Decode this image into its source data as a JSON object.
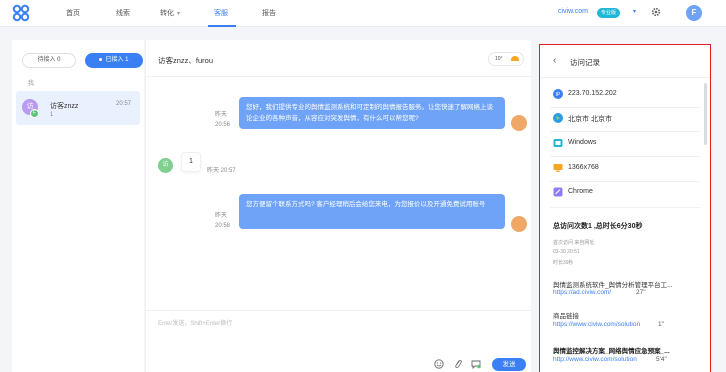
{
  "topbar": {
    "nav": [
      "首页",
      "线索",
      "转化",
      "客服",
      "报告"
    ],
    "active_nav": "客服",
    "site": "civiw.com",
    "edition_badge": "专业版",
    "avatar_letter": "F"
  },
  "left": {
    "tab_waiting": "待接入 0",
    "tab_joined": "已接入 1",
    "group_label": "我",
    "conversation": {
      "avatar": "访",
      "sub_avatar": "F",
      "name": "访客znzz",
      "time": "20:57",
      "last_message": "1"
    }
  },
  "chat": {
    "title": "访客znzz、furou",
    "weather_temp": "10°",
    "messages": [
      {
        "from": "agent",
        "day": "昨天",
        "time": "20:56",
        "text": "您好，我们提供专业的舆情监测系统和可定制的舆情报告服务。让您快速了解网络上谈论企业的各种声音，从容应对突发舆情，有什么可以帮您呢?"
      },
      {
        "from": "visitor",
        "avatar": "访",
        "text": "1",
        "time": "昨天 20:57"
      },
      {
        "from": "agent",
        "day": "昨天",
        "time": "20:58",
        "text": "您方便留个联系方式吗? 客户经理稍后会给您来电，为您报价以及开通免费试用账号"
      }
    ],
    "input_placeholder": "Enter发送，Shift+Enter换行",
    "send_label": "发送"
  },
  "visit": {
    "title": "访问记录",
    "ip": "223.70.152.202",
    "location": "北京市 北京市",
    "os": "Windows",
    "resolution": "1366x768",
    "browser": "Chrome",
    "stats": "总访问次数1 ,总时长6分30秒",
    "meta_labels": "首次访问   来自网址",
    "first_visit": "03-30 20:51",
    "duration": "时长39秒",
    "sources": [
      {
        "title": "舆情监测系统软件_舆情分析管理平台工...",
        "url": "https://ad.civiw.com/",
        "dur": "27\"",
        "bold": false
      },
      {
        "title": "商品链接",
        "url": "https://www.civiw.com/solution",
        "dur": "1\"",
        "bold": false
      },
      {
        "title": "舆情监控解决方案_网络舆情应急预案_...",
        "url": "http://www.civiw.com/solution",
        "dur": "5'4\"",
        "bold": true
      }
    ]
  },
  "colors": {
    "accent": "#3b7ff5",
    "bubble": "#6fa3f8",
    "highlight_border": "#e02020"
  }
}
